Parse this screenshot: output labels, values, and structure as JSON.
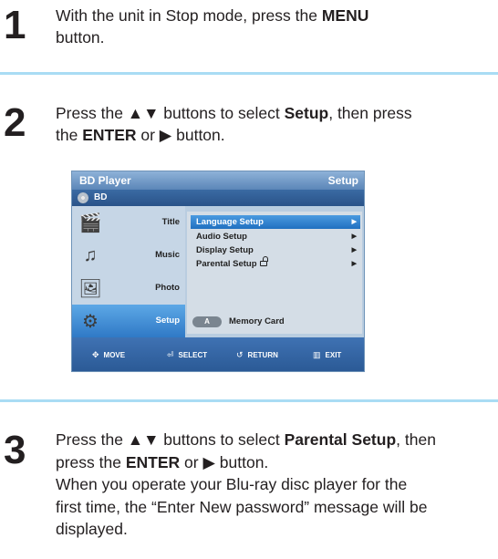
{
  "steps": [
    {
      "number": "1",
      "lines": [
        {
          "parts": [
            "With the unit in Stop mode, press the ",
            "MENU",
            ""
          ]
        },
        {
          "parts": [
            "button.",
            "",
            ""
          ]
        }
      ]
    },
    {
      "number": "2",
      "lines": [
        {
          "parts": [
            "Press the ▲▼ buttons to select ",
            "Setup",
            ", then press"
          ]
        },
        {
          "parts": [
            "the ",
            "ENTER",
            " or ▶ button."
          ]
        }
      ]
    },
    {
      "number": "3",
      "lines": [
        {
          "parts": [
            "Press the ▲▼ buttons to select ",
            "Parental Setup",
            ", then"
          ]
        },
        {
          "parts": [
            "press the ",
            "ENTER",
            " or ▶ button."
          ]
        },
        {
          "parts": [
            "When you operate your Blu-ray disc player for the",
            "",
            ""
          ]
        },
        {
          "parts": [
            "first time, the “Enter New password” message will be",
            "",
            ""
          ]
        },
        {
          "parts": [
            "displayed.",
            "",
            ""
          ]
        }
      ]
    }
  ],
  "osd": {
    "header_left": "BD Player",
    "header_right": "Setup",
    "sub_label": "BD",
    "side_items": [
      {
        "label": "Title",
        "icon": "disc-person-icon",
        "glyph": "🎬"
      },
      {
        "label": "Music",
        "icon": "music-note-icon",
        "glyph": "♫"
      },
      {
        "label": "Photo",
        "icon": "photo-icon",
        "glyph": "🖼"
      },
      {
        "label": "Setup",
        "icon": "setup-icon",
        "glyph": "⚙"
      }
    ],
    "menu_items": [
      {
        "label": "Language Setup",
        "arrow": "▶"
      },
      {
        "label": "Audio Setup",
        "arrow": "▶"
      },
      {
        "label": "Display Setup",
        "arrow": "▶"
      },
      {
        "label": "Parental Setup",
        "arrow": "▶"
      }
    ],
    "memory_button": "A",
    "memory_label": "Memory Card",
    "footer": [
      {
        "icon": "move-icon",
        "glyph": "✥",
        "label": "MOVE"
      },
      {
        "icon": "select-icon",
        "glyph": "⏎",
        "label": "SELECT"
      },
      {
        "icon": "return-icon",
        "glyph": "↺",
        "label": "RETURN"
      },
      {
        "icon": "exit-icon",
        "glyph": "▥",
        "label": "EXIT"
      }
    ]
  }
}
